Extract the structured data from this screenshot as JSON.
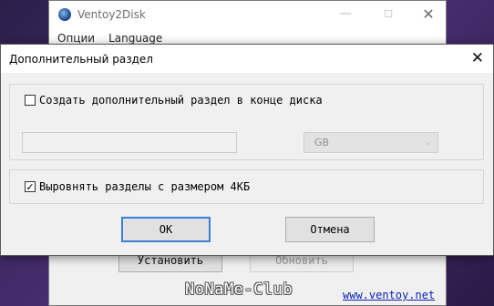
{
  "background_window": {
    "title": "Ventoy2Disk",
    "menu": [
      "Опции",
      "Language"
    ],
    "install_label": "Установить",
    "update_label": "Обновить",
    "link": "www.ventoy.net"
  },
  "watermark": "NoNaMe-Club",
  "dialog": {
    "title": "Дополнительный раздел",
    "create_partition": {
      "label": "Создать дополнительный раздел в конце диска",
      "checked": false
    },
    "size_input": {
      "value": "",
      "enabled": false
    },
    "unit_select": {
      "value": "GB",
      "enabled": false
    },
    "align_partitions": {
      "label": "Выровнять разделы с размером 4КБ",
      "checked": true
    },
    "ok_label": "ОК",
    "cancel_label": "Отмена"
  },
  "colors": {
    "desktop": "#3b2a5e",
    "focus_border": "#3c7fd6",
    "link": "#0b22b5"
  },
  "icons": [
    "ventoy-logo-icon",
    "minimize-icon",
    "maximize-icon",
    "close-icon",
    "checkbox-checked-icon",
    "chevron-down-icon"
  ]
}
